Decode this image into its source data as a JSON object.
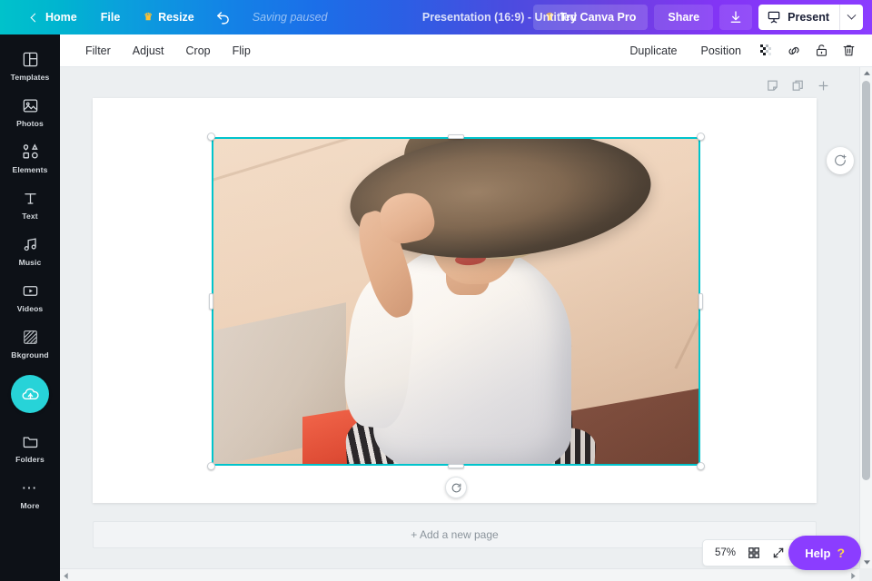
{
  "topbar": {
    "home_label": "Home",
    "file_label": "File",
    "resize_label": "Resize",
    "saving_status": "Saving paused",
    "doc_title": "Presentation (16:9) - Untitled",
    "try_pro_label": "Try Canva Pro",
    "share_label": "Share",
    "present_label": "Present",
    "gradient_start": "#00c2cb",
    "gradient_mid": "#1b6fe8",
    "gradient_end": "#8b3dff"
  },
  "sidebar": {
    "items": [
      {
        "label": "Templates",
        "icon": "templates-icon"
      },
      {
        "label": "Photos",
        "icon": "photos-icon"
      },
      {
        "label": "Elements",
        "icon": "elements-icon"
      },
      {
        "label": "Text",
        "icon": "text-icon"
      },
      {
        "label": "Music",
        "icon": "music-icon"
      },
      {
        "label": "Videos",
        "icon": "videos-icon"
      },
      {
        "label": "Bkground",
        "icon": "background-icon"
      }
    ],
    "upload": {
      "icon": "cloud-upload-icon",
      "color": "#27d3d8"
    },
    "items_lower": [
      {
        "label": "Folders",
        "icon": "folder-icon"
      },
      {
        "label": "More",
        "icon": "more-dots-icon"
      }
    ],
    "background_color": "#0d1117"
  },
  "toolbar": {
    "left": [
      {
        "label": "Filter"
      },
      {
        "label": "Adjust"
      },
      {
        "label": "Crop"
      },
      {
        "label": "Flip"
      }
    ],
    "duplicate_label": "Duplicate",
    "position_label": "Position",
    "icons": [
      {
        "name": "transparency-icon"
      },
      {
        "name": "link-icon"
      },
      {
        "name": "lock-icon"
      },
      {
        "name": "trash-icon"
      }
    ]
  },
  "page_tools": [
    {
      "name": "notes-icon"
    },
    {
      "name": "duplicate-page-icon"
    },
    {
      "name": "add-page-icon"
    }
  ],
  "canvas": {
    "add_page_label": "+ Add a new page",
    "selection_color": "#00c4cc",
    "page_background": "#ffffff",
    "workspace_background": "#eceff1"
  },
  "photo": {
    "description": "Woman in wide-brimmed sun hat and sunglasses wearing white blouse and black-white striped pants, seated outdoors on concrete",
    "alt": "fashion-photo"
  },
  "zoom_controls": {
    "zoom_level": "57%",
    "grid_icon": "grid-view-icon",
    "fullscreen_icon": "expand-icon"
  },
  "help": {
    "label": "Help",
    "symbol": "?",
    "color": "#8b3dff"
  }
}
